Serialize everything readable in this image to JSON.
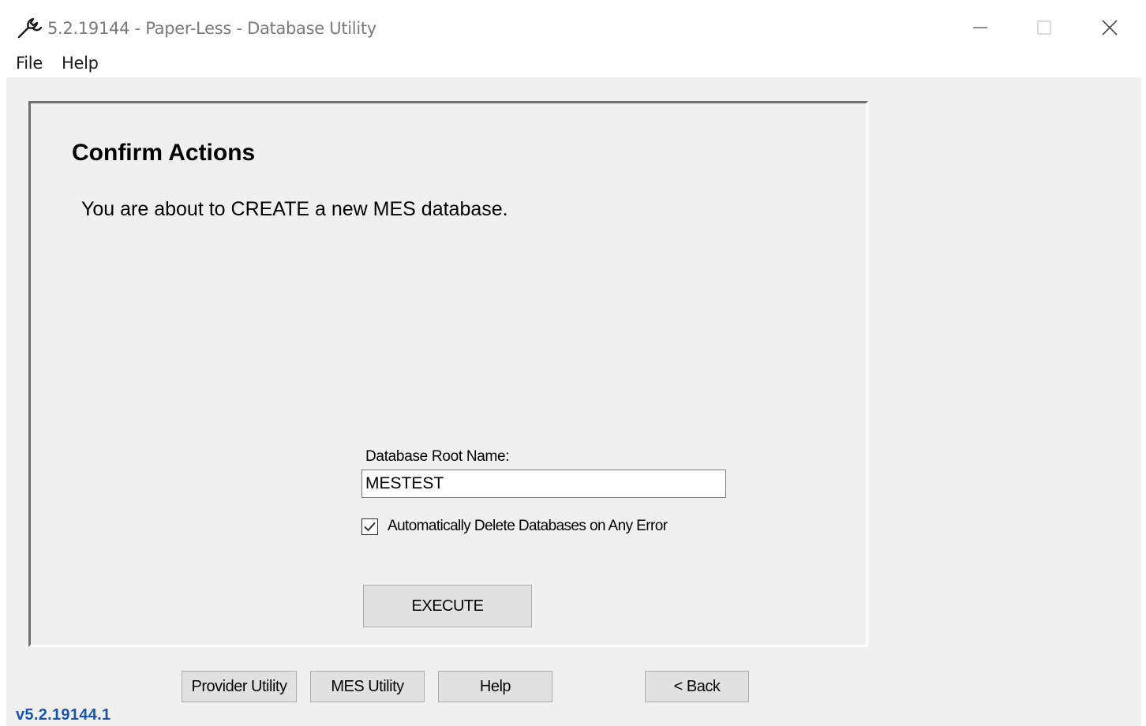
{
  "window": {
    "title": "5.2.19144 - Paper-Less - Database Utility",
    "icon": "wrench-icon",
    "controls": [
      "minimize-icon",
      "maximize-icon",
      "close-icon"
    ]
  },
  "menu": {
    "items": [
      {
        "label": "File"
      },
      {
        "label": "Help"
      }
    ]
  },
  "panel": {
    "title": "Confirm Actions",
    "message": "You are about to CREATE a new MES database.",
    "db_root_label": "Database Root Name:",
    "db_root_value": "MESTEST",
    "auto_delete_checkbox": {
      "label": "Automatically Delete Databases on Any Error",
      "checked": true
    },
    "execute_label": "EXECUTE"
  },
  "footer": {
    "buttons": [
      {
        "label": "Provider Utility"
      },
      {
        "label": "MES Utility"
      },
      {
        "label": "Help"
      },
      {
        "label": "< Back"
      }
    ],
    "version": "v5.2.19144.1"
  },
  "colors": {
    "window_bg": "#f0f0f0",
    "version_text": "#1a56a8",
    "button_bg": "#e1e1e1"
  }
}
